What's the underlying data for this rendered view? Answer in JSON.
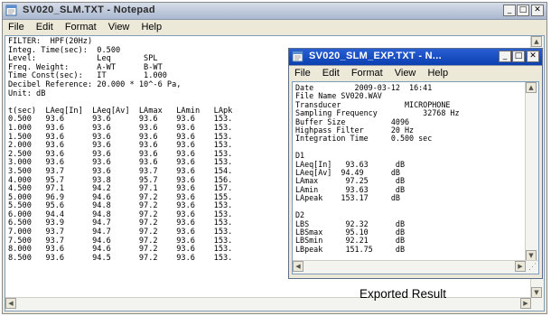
{
  "main_window": {
    "title": "SV020_SLM.TXT - Notepad",
    "menu": [
      "File",
      "Edit",
      "Format",
      "View",
      "Help"
    ],
    "header_lines": [
      "FILTER:  HPF(20Hz)",
      "Integ. Time(sec):  0.500",
      "Level:             Leq       SPL",
      "Freq. Weight:      A-WT      B-WT",
      "Time Const(sec):   IT        1.000",
      "Decibel Reference: 20.000 * 10^-6 Pa,",
      "Unit: dB"
    ],
    "table_header": [
      "t(sec)",
      "LAeq[In]",
      "LAeq[Av]",
      "LAmax",
      "LAmin",
      "LApk"
    ],
    "rows": [
      [
        "0.500",
        "93.6",
        "93.6",
        "93.6",
        "93.6",
        "153."
      ],
      [
        "1.000",
        "93.6",
        "93.6",
        "93.6",
        "93.6",
        "153."
      ],
      [
        "1.500",
        "93.6",
        "93.6",
        "93.6",
        "93.6",
        "153."
      ],
      [
        "2.000",
        "93.6",
        "93.6",
        "93.6",
        "93.6",
        "153."
      ],
      [
        "2.500",
        "93.6",
        "93.6",
        "93.6",
        "93.6",
        "153."
      ],
      [
        "3.000",
        "93.6",
        "93.6",
        "93.6",
        "93.6",
        "153."
      ],
      [
        "3.500",
        "93.7",
        "93.6",
        "93.7",
        "93.6",
        "154."
      ],
      [
        "4.000",
        "95.7",
        "93.8",
        "95.7",
        "93.6",
        "156."
      ],
      [
        "4.500",
        "97.1",
        "94.2",
        "97.1",
        "93.6",
        "157."
      ],
      [
        "5.000",
        "96.9",
        "94.6",
        "97.2",
        "93.6",
        "155."
      ],
      [
        "5.500",
        "95.6",
        "94.8",
        "97.2",
        "93.6",
        "153."
      ],
      [
        "6.000",
        "94.4",
        "94.8",
        "97.2",
        "93.6",
        "153."
      ],
      [
        "6.500",
        "93.9",
        "94.7",
        "97.2",
        "93.6",
        "153."
      ],
      [
        "7.000",
        "93.7",
        "94.7",
        "97.2",
        "93.6",
        "153."
      ],
      [
        "7.500",
        "93.7",
        "94.6",
        "97.2",
        "93.6",
        "153."
      ],
      [
        "8.000",
        "93.6",
        "94.6",
        "97.2",
        "93.6",
        "153."
      ],
      [
        "8.500",
        "93.6",
        "94.5",
        "97.2",
        "93.6",
        "153."
      ]
    ]
  },
  "export_window": {
    "title": "SV020_SLM_EXP.TXT - N...",
    "menu": [
      "File",
      "Edit",
      "Format",
      "View",
      "Help"
    ],
    "lines": [
      "Date         2009-03-12  16:41",
      "File Name SV020.WAV",
      "Transducer              MICROPHONE",
      "Sampling Frequency          32768 Hz",
      "Buffer Size          4096",
      "Highpass Filter      20 Hz",
      "Integration Time     0.500 sec",
      "",
      "D1",
      "LAeq[In]   93.63      dB",
      "LAeq[Av]  94.49      dB",
      "LAmax      97.25      dB",
      "LAmin      93.63      dB",
      "LApeak    153.17     dB",
      "",
      "D2",
      "LBS        92.32      dB",
      "LBSmax     95.10      dB",
      "LBSmin     92.21      dB",
      "LBpeak     151.75     dB"
    ]
  },
  "caption": "Exported Result",
  "icons": {
    "notepad": "notepad-icon",
    "minimize": "minimize-icon",
    "maximize": "maximize-icon",
    "close": "close-icon"
  },
  "colors": {
    "active_titlebar": "#0a3fb0",
    "inactive_titlebar": "#c4cfe0"
  }
}
